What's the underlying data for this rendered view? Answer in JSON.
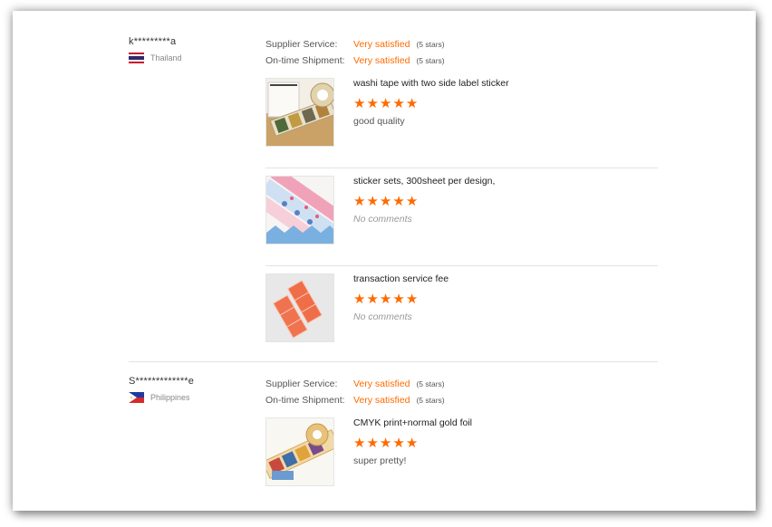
{
  "reviews": [
    {
      "buyer_name": "k*********a",
      "country": "Thailand",
      "supplier_service_label": "Supplier Service:",
      "supplier_service_value": "Very satisfied",
      "supplier_service_stars": "(5 stars)",
      "shipment_label": "On-time Shipment:",
      "shipment_value": "Very satisfied",
      "shipment_stars": "(5 stars)",
      "items": [
        {
          "title": "washi tape with two side label sticker",
          "rating": 5,
          "comment": "good quality"
        },
        {
          "title": "sticker sets, 300sheet per design,",
          "rating": 5,
          "comment": "No comments"
        },
        {
          "title": "transaction service fee",
          "rating": 5,
          "comment": "No comments"
        }
      ]
    },
    {
      "buyer_name": "S*************e",
      "country": "Philippines",
      "supplier_service_label": "Supplier Service:",
      "supplier_service_value": "Very satisfied",
      "supplier_service_stars": "(5 stars)",
      "shipment_label": "On-time Shipment:",
      "shipment_value": "Very satisfied",
      "shipment_stars": "(5 stars)",
      "items": [
        {
          "title": "CMYK print+normal gold foil",
          "rating": 5,
          "comment": "super pretty!"
        }
      ]
    }
  ],
  "colors": {
    "accent": "#ff6a00",
    "divider": "#e3e3e3"
  },
  "icons": {
    "star": "star-icon",
    "flag_thailand": "thailand-flag-icon",
    "flag_philippines": "philippines-flag-icon"
  }
}
